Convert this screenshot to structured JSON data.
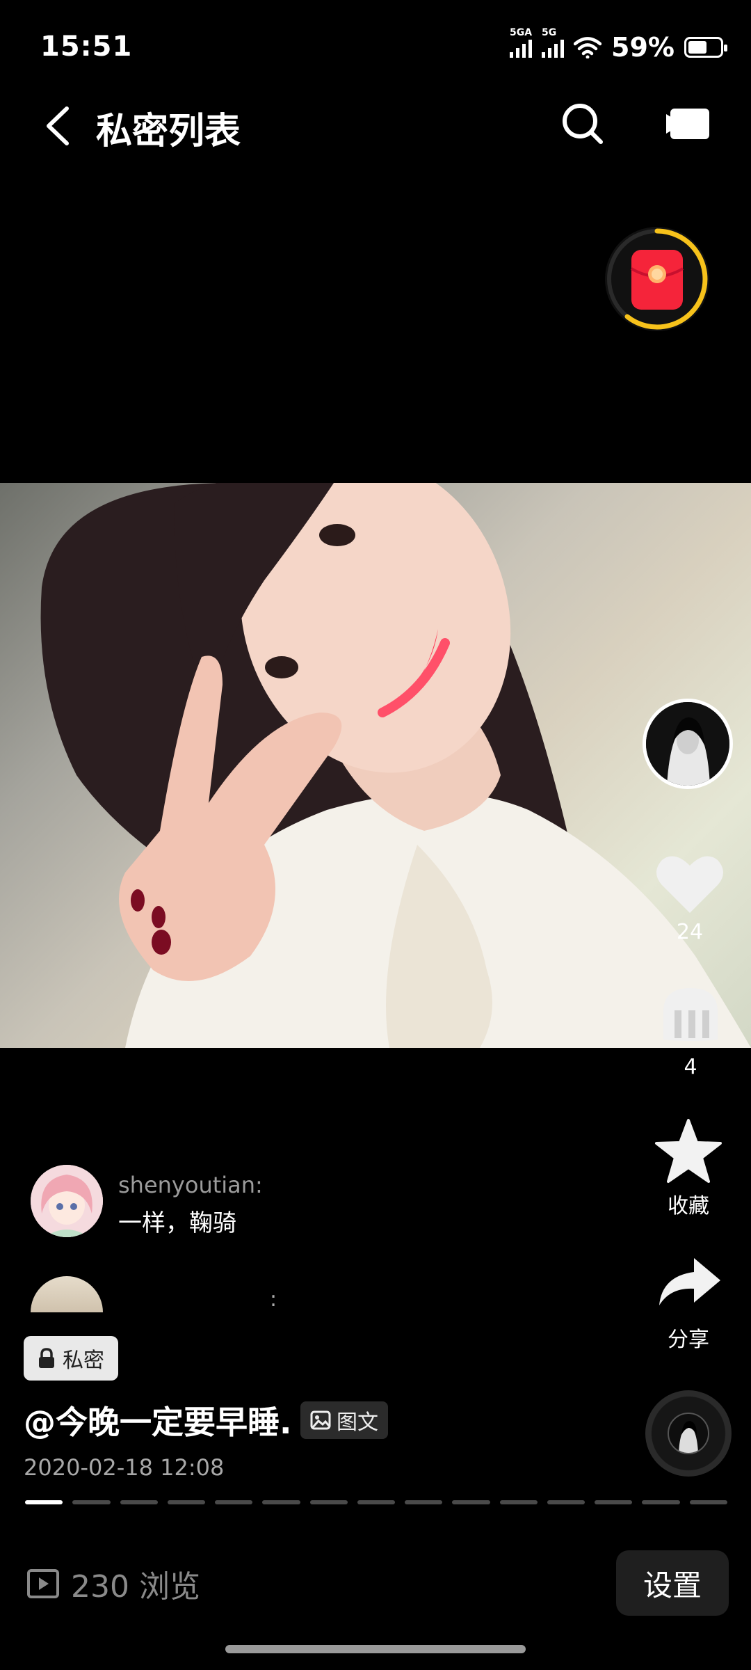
{
  "status_bar": {
    "time": "15:51",
    "signal1_label": "5GA",
    "signal2_label": "5G",
    "battery_percent": "59%",
    "battery_level": 0.59
  },
  "header": {
    "title": "私密列表",
    "icons": [
      "back-icon",
      "search-icon",
      "camera-icon"
    ]
  },
  "side_actions": {
    "like_count": "24",
    "comment_count": "4",
    "favorite_label": "收藏",
    "share_label": "分享"
  },
  "comments": [
    {
      "user": "shenyoutian:",
      "text": "一样，鞠骑"
    },
    {
      "user": "",
      "text": ":"
    }
  ],
  "post": {
    "privacy_label": "私密",
    "title": "@今晚一定要早睡.",
    "type_tag": "图文",
    "date": "2020-02-18 12:08",
    "image_count": 15,
    "current_image": 1
  },
  "bottom_bar": {
    "views": "230 浏览",
    "settings_label": "设置"
  },
  "colors": {
    "background": "#000000",
    "accent_red": "#f5243a",
    "accent_yellow": "#f7c21b"
  }
}
